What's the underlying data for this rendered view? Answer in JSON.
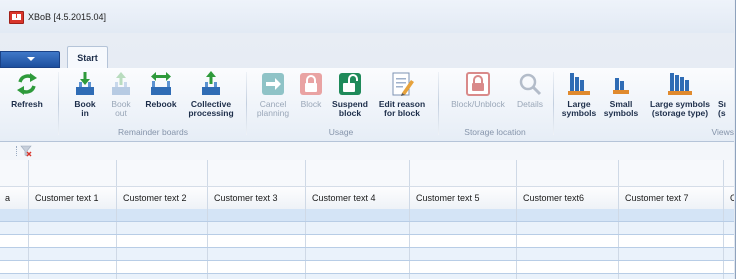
{
  "window": {
    "title": "XBoB [4.5.2015.04]"
  },
  "tabs": {
    "start": "Start"
  },
  "ribbon": {
    "buttons": {
      "refresh": "Refresh",
      "book_in": "Book\nin",
      "book_out": "Book\nout",
      "rebook": "Rebook",
      "collective": "Collective\nprocessing",
      "cancel_planning": "Cancel\nplanning",
      "block": "Block",
      "suspend_block": "Suspend\nblock",
      "edit_reason": "Edit reason\nfor block",
      "block_unblock": "Block/Unblock",
      "details": "Details",
      "large_symbols": "Large\nsymbols",
      "small_symbols": "Small\nsymbols",
      "large_symbols_storage": "Large symbols\n(storage type)",
      "cut_off": "Sı\n(s"
    },
    "groups": {
      "remainder_boards": "Remainder boards",
      "usage": "Usage",
      "storage_location": "Storage location",
      "views": "Views"
    }
  },
  "grid": {
    "columns": [
      "a",
      "Customer text 1",
      "Customer text 2",
      "Customer text 3",
      "Customer text 4",
      "Customer text 5",
      "Customer text6",
      "Customer text 7",
      "C"
    ]
  },
  "colors": {
    "accent": "#1d4f9e",
    "refresh_green": "#2e9a3b",
    "lock_red": "#d9352b",
    "selected_row": "#d4e4f6"
  }
}
